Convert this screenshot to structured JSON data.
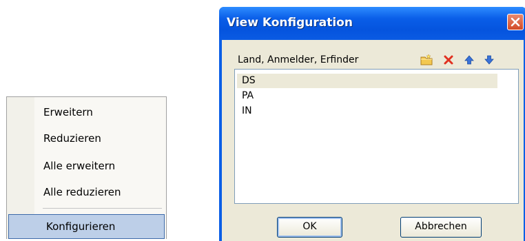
{
  "context_menu": {
    "items": [
      {
        "label": "Erweitern"
      },
      {
        "label": "Reduzieren"
      },
      {
        "label": "Alle erweitern"
      },
      {
        "label": "Alle reduzieren"
      }
    ],
    "selected_item": {
      "label": "Konfigurieren"
    }
  },
  "dialog": {
    "title": "View Konfiguration",
    "close_icon": "close-icon",
    "list_header": {
      "label": "Land, Anmelder, Erfinder",
      "toolbar_icons": [
        "folder-icon",
        "delete-icon",
        "arrow-up-icon",
        "arrow-down-icon"
      ]
    },
    "list_items": [
      "DS",
      "PA",
      "IN"
    ],
    "buttons": {
      "ok": "OK",
      "cancel": "Abbrechen"
    }
  },
  "colors": {
    "titlebar": "#0a5ee8",
    "dialog_background": "#ece9d8",
    "selection": "#bdcfe8"
  }
}
